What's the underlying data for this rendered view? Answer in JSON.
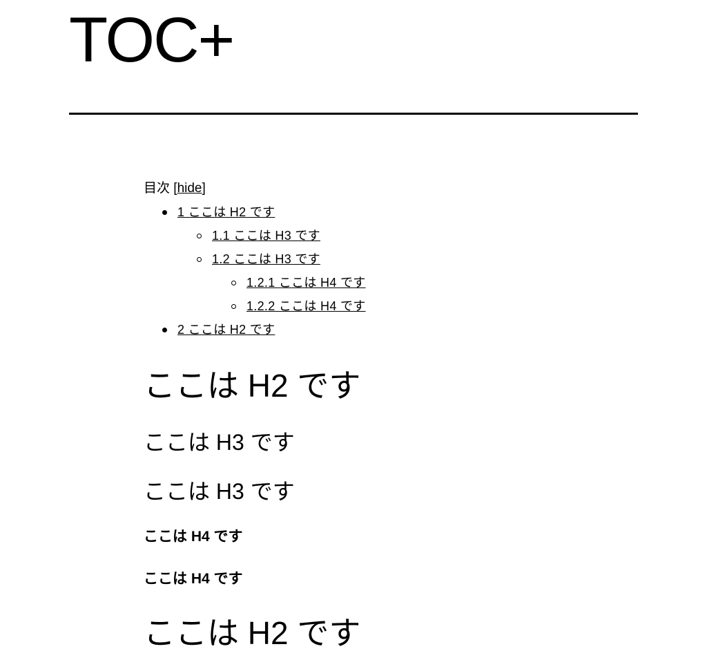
{
  "site": {
    "title": "TOC+"
  },
  "toc": {
    "title": "目次",
    "toggle_open": "[",
    "toggle_label": "hide",
    "toggle_close": "]",
    "items": [
      {
        "label": "1 ここは H2 です",
        "level": 1
      },
      {
        "label": "1.1 ここは H3 です",
        "level": 2
      },
      {
        "label": "1.2 ここは H3 です",
        "level": 2
      },
      {
        "label": "1.2.1 ここは H4 です",
        "level": 3
      },
      {
        "label": "1.2.2 ここは H4 です",
        "level": 3
      },
      {
        "label": "2 ここは H2 です",
        "level": 1
      }
    ]
  },
  "headings": [
    {
      "tag": "h2",
      "text": "ここは H2 です"
    },
    {
      "tag": "h3",
      "text": "ここは H3 です"
    },
    {
      "tag": "h3",
      "text": "ここは H3 です"
    },
    {
      "tag": "h4",
      "text": "ここは H4 です"
    },
    {
      "tag": "h4",
      "text": "ここは H4 です"
    },
    {
      "tag": "h2",
      "text": "ここは H2 です"
    }
  ]
}
